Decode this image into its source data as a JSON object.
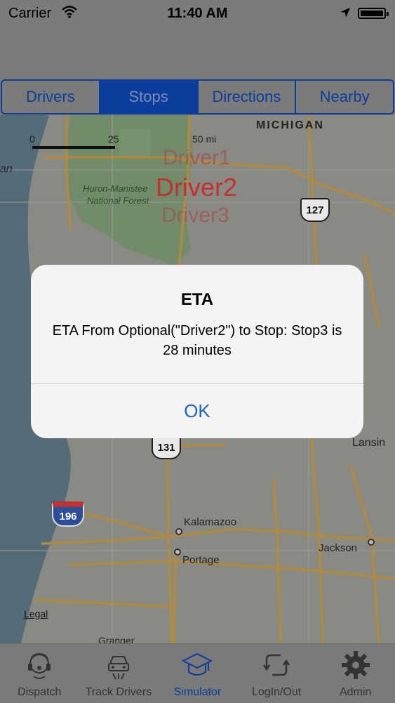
{
  "status_bar": {
    "carrier": "Carrier",
    "time": "11:40 AM"
  },
  "segments": [
    "Drivers",
    "Stops",
    "Directions",
    "Nearby"
  ],
  "active_segment": "Stops",
  "map": {
    "state_label": "MICHIGAN",
    "forest_label_1": "Huron-Manistee",
    "forest_label_2": "National Forest",
    "scale": {
      "zero": "0",
      "mid": "25",
      "end": "50 mi"
    },
    "driver_labels": [
      "Driver1",
      "Driver2",
      "Driver3"
    ],
    "edge_label_left": "an",
    "cities": {
      "kalamazoo": "Kalamazoo",
      "portage": "Portage",
      "jackson": "Jackson",
      "lansing": "Lansin"
    },
    "shields": {
      "us127": "127",
      "us131": "131",
      "i196": "196"
    },
    "legal": "Legal",
    "bottom_partial": "Granger"
  },
  "alert": {
    "title": "ETA",
    "message": "ETA From Optional(\"Driver2\") to Stop: Stop3 is 28 minutes",
    "ok_label": "OK"
  },
  "tabs": [
    {
      "label": "Dispatch",
      "icon": "headset-icon"
    },
    {
      "label": "Track Drivers",
      "icon": "car-icon"
    },
    {
      "label": "Simulator",
      "icon": "graduation-cap-icon"
    },
    {
      "label": "LogIn/Out",
      "icon": "refresh-icon"
    },
    {
      "label": "Admin",
      "icon": "gear-icon"
    }
  ],
  "active_tab": "Simulator",
  "colors": {
    "accent": "#0b3d9c",
    "driver_text": "#c23030",
    "alert_button": "#1e64c8"
  }
}
